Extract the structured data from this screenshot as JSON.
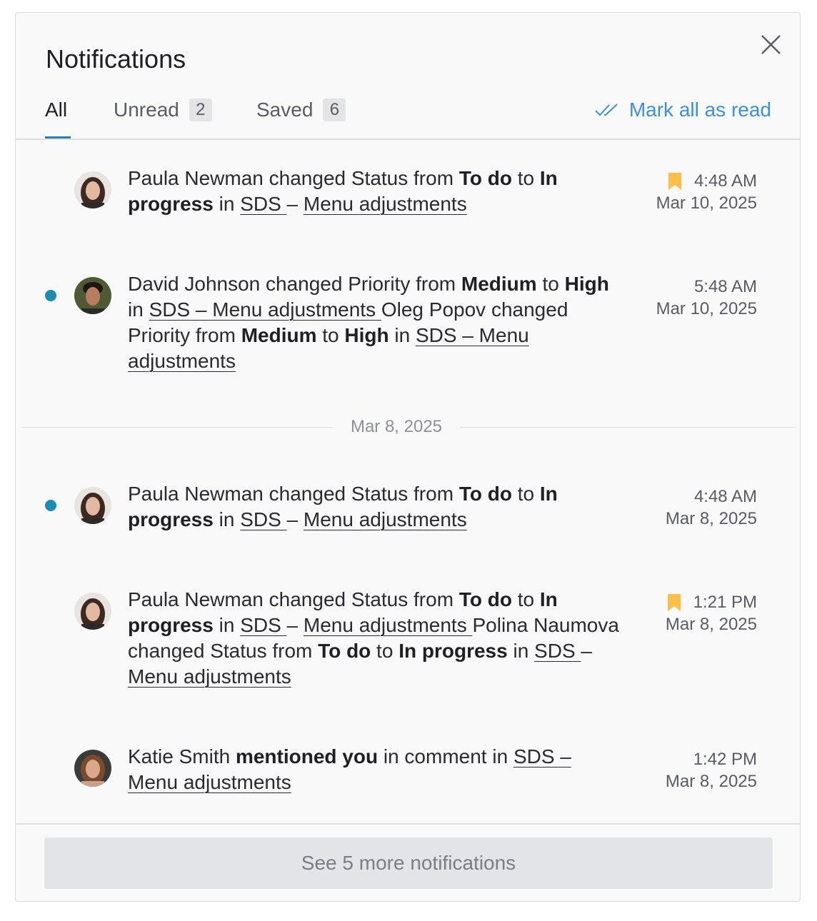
{
  "header": {
    "title": "Notifications"
  },
  "tabs": [
    {
      "label": "All",
      "count": ""
    },
    {
      "label": "Unread",
      "count": "2"
    },
    {
      "label": "Saved",
      "count": "6"
    }
  ],
  "mark_all_label": "Mark all as read",
  "colors": {
    "accent": "#3990e6",
    "unread_dot": "#1d8cb3",
    "bookmark": "#fbbf4a"
  },
  "notifications": [
    {
      "unread": false,
      "saved": true,
      "time": "4:48 AM",
      "date": "Mar 10, 2025",
      "t1": "Paula Newman changed Status from ",
      "b1": "To do",
      "t2": " to ",
      "b2": "In progress",
      "t3": " in ",
      "l1": "SDS ",
      "t4": "– ",
      "l2": "Menu adjustments"
    },
    {
      "unread": true,
      "saved": false,
      "time": "5:48 AM",
      "date": "Mar 10, 2025",
      "t1": "David Johnson changed Priority from ",
      "b1": "Medium",
      "t2": " to ",
      "b2": "High",
      "t3": " in ",
      "l1": "SDS – Menu adjustments ",
      "t4": "Oleg Popov changed Priority from ",
      "b3": "Medium",
      "t5": " to ",
      "b4": "High",
      "t6": " in ",
      "l2": "SDS – Menu adjustments"
    },
    {
      "unread": true,
      "saved": false,
      "time": "4:48 AM",
      "date": "Mar 8, 2025",
      "t1": "Paula Newman changed Status from ",
      "b1": "To do",
      "t2": " to ",
      "b2": "In progress",
      "t3": " in ",
      "l1": "SDS ",
      "t4": "– ",
      "l2": "Menu adjustments"
    },
    {
      "unread": false,
      "saved": true,
      "time": "1:21 PM",
      "date": "Mar 8, 2025",
      "t1": "Paula Newman changed Status from ",
      "b1": "To do",
      "t2": " to ",
      "b2": "In progress",
      "t3": " in ",
      "l1": "SDS ",
      "t4": "– ",
      "l2": "Menu adjustments ",
      "t5": "Polina Naumova changed Status from ",
      "b3": "To do",
      "t6": " to ",
      "b4": "In progress",
      "t7": " in ",
      "l3": "SDS ",
      "t8": "– ",
      "l4": "Menu adjustments"
    },
    {
      "unread": false,
      "saved": false,
      "time": "1:42 PM",
      "date": "Mar 8, 2025",
      "t1": "Katie Smith ",
      "b1": "mentioned you",
      "t2": " in comment in ",
      "l1": "SDS – Menu adjustments"
    }
  ],
  "date_separator": "Mar 8, 2025",
  "footer": {
    "more_label": "See 5 more notifications"
  }
}
